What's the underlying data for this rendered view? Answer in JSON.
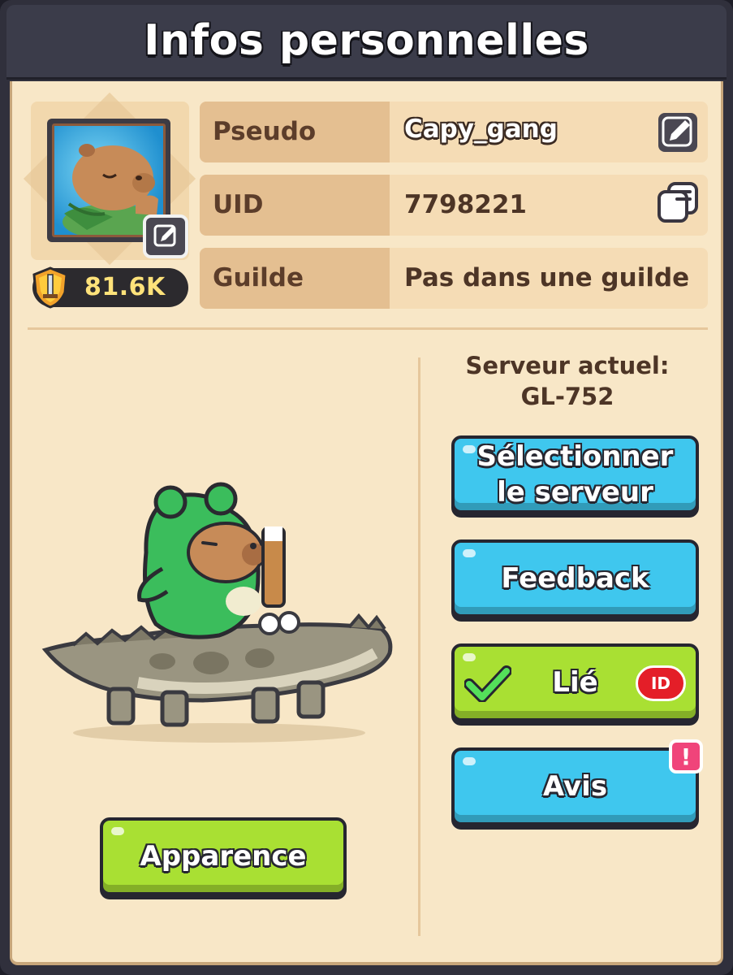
{
  "header": {
    "title": "Infos personnelles"
  },
  "profile": {
    "power": "81.6K",
    "rows": [
      {
        "label": "Pseudo",
        "value": "Capy_gang"
      },
      {
        "label": "UID",
        "value": "7798221"
      },
      {
        "label": "Guilde",
        "value": "Pas dans une guilde"
      }
    ]
  },
  "server": {
    "label": "Serveur actuel:",
    "value": "GL-752"
  },
  "buttons": {
    "select_server_line1": "Sélectionner",
    "select_server_line2": "le serveur",
    "feedback": "Feedback",
    "linked": "Lié",
    "linked_badge": "ID",
    "notice": "Avis",
    "notice_alert": "!",
    "appearance": "Apparence"
  },
  "icons": {
    "avatar_edit": "pencil-icon",
    "name_edit": "pencil-icon",
    "uid_copy": "copy-icon",
    "power": "sword-shield-icon",
    "linked": "checkmark-icon"
  },
  "colors": {
    "panel": "#f8e7c7",
    "blue_button": "#3fc7ee",
    "green_button": "#a9e033",
    "alert": "#f0447a",
    "id_badge": "#e41e28"
  }
}
